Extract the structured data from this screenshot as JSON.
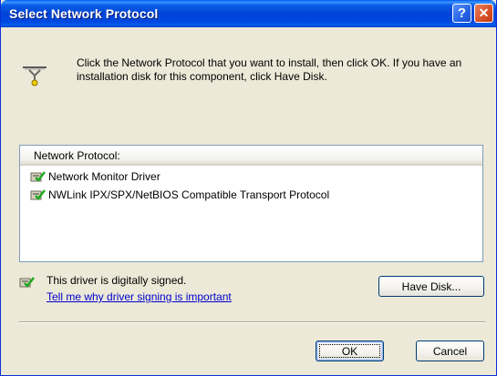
{
  "window": {
    "title": "Select Network Protocol",
    "help_glyph": "?",
    "close_glyph": "✕"
  },
  "instruction_text": "Click the Network Protocol that you want to install, then click OK. If you have an installation disk for this component, click Have Disk.",
  "list": {
    "header": "Network Protocol:",
    "items": [
      {
        "label": "Network Monitor Driver",
        "icon": "signed-driver-icon"
      },
      {
        "label": "NWLink IPX/SPX/NetBIOS Compatible Transport Protocol",
        "icon": "signed-driver-icon"
      }
    ]
  },
  "signing": {
    "status_text": "This driver is digitally signed.",
    "link_text": "Tell me why driver signing is important",
    "icon": "signed-driver-icon"
  },
  "buttons": {
    "have_disk": "Have Disk...",
    "ok": "OK",
    "cancel": "Cancel"
  },
  "colors": {
    "titlebar": "#0054e3",
    "dialog_bg": "#ece9d8",
    "link": "#0000cc"
  }
}
